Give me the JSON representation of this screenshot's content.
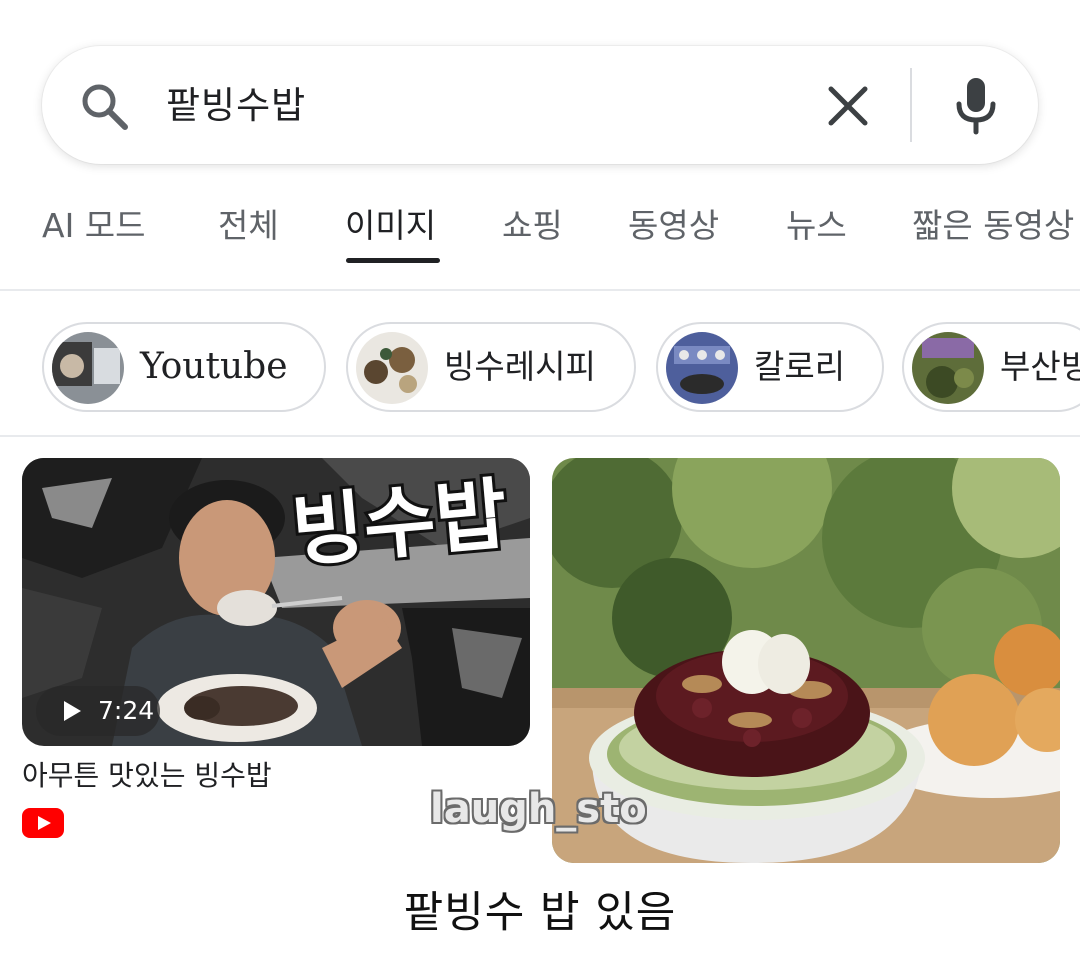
{
  "search": {
    "query": "팥빙수밥"
  },
  "tabs": [
    {
      "label": "AI 모드",
      "active": false
    },
    {
      "label": "전체",
      "active": false
    },
    {
      "label": "이미지",
      "active": true
    },
    {
      "label": "쇼핑",
      "active": false
    },
    {
      "label": "동영상",
      "active": false
    },
    {
      "label": "뉴스",
      "active": false
    },
    {
      "label": "짧은 동영상",
      "active": false
    }
  ],
  "chips": [
    {
      "label": "Youtube"
    },
    {
      "label": "빙수레시피"
    },
    {
      "label": "칼로리"
    },
    {
      "label": "부산빙"
    }
  ],
  "results": [
    {
      "overlay_text": "빙수밥",
      "duration": "7:24",
      "title": "아무튼 맛있는 빙수밥",
      "source_icon": "youtube-icon"
    },
    {
      "image": "patbingsu-photo"
    }
  ],
  "watermark": "laugh_sto",
  "caption": "팥빙수 밥 있음",
  "colors": {
    "youtube_red": "#ff0000",
    "active_tab": "#202124",
    "inactive_tab": "#5f6368"
  }
}
